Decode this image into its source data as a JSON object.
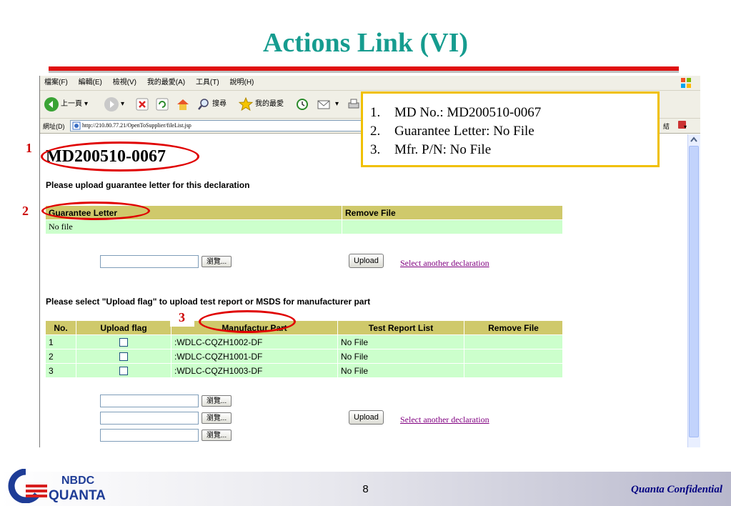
{
  "slide": {
    "title": "Actions Link (VI)",
    "page_number": "8",
    "confidential": "Quanta Confidential",
    "logo_line1": "NBDC",
    "logo_line2": "QUANTA"
  },
  "browser": {
    "menu": [
      "檔案(F)",
      "編輯(E)",
      "檢視(V)",
      "我的最愛(A)",
      "工具(T)",
      "說明(H)"
    ],
    "toolbar": {
      "back_label": "上一頁",
      "search_label": "搜尋",
      "favorites_label": "我的最愛"
    },
    "address_label": "網址(D)",
    "address_value": "http://210.80.77.21/OpenToSupplier/fileList.jsp",
    "links_label": "結"
  },
  "page": {
    "md_number": "MD200510-0067",
    "guarantee_prompt": "Please upload guarantee letter for this declaration",
    "guarantee_table": {
      "headers": [
        "Guarantee Letter",
        "Remove File"
      ],
      "row": [
        "No file",
        ""
      ]
    },
    "browse_label": "瀏覽...",
    "upload_label": "Upload",
    "select_another": "Select another declaration",
    "flag_prompt": "Please select \"Upload flag\" to upload test report or MSDS for manufacturer part",
    "parts_table": {
      "headers": [
        "No.",
        "Upload flag",
        "Manufactur Part",
        "Test Report List",
        "Remove File"
      ],
      "rows": [
        {
          "no": "1",
          "part": ":WDLC-CQZH1002-DF",
          "report": "No File"
        },
        {
          "no": "2",
          "part": ":WDLC-CQZH1001-DF",
          "report": "No File"
        },
        {
          "no": "3",
          "part": ":WDLC-CQZH1003-DF",
          "report": "No File"
        }
      ]
    }
  },
  "callout": {
    "items": [
      {
        "num": "1.",
        "text": "MD No.: MD200510-0067"
      },
      {
        "num": "2.",
        "text": "Guarantee Letter: No File"
      },
      {
        "num": "3.",
        "text": "Mfr. P/N: No File"
      }
    ]
  },
  "markers": [
    "1",
    "2",
    "3"
  ]
}
